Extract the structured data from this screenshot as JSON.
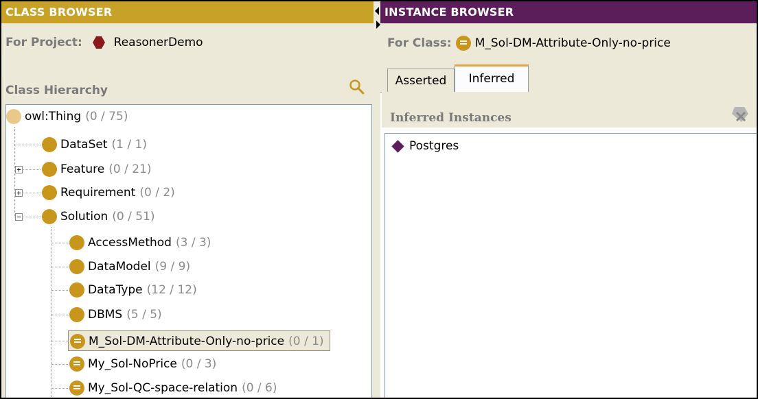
{
  "class_browser": {
    "header": "CLASS BROWSER",
    "project_label": "For Project:",
    "project_name": "ReasonerDemo",
    "hierarchy_title": "Class Hierarchy",
    "tree": [
      {
        "name": "owl:Thing",
        "count": "(0 / 75)"
      },
      {
        "name": "DataSet",
        "count": "(1 / 1)"
      },
      {
        "name": "Feature",
        "count": "(0 / 21)"
      },
      {
        "name": "Requirement",
        "count": "(0 / 2)"
      },
      {
        "name": "Solution",
        "count": "(0 / 51)"
      },
      {
        "name": "AccessMethod",
        "count": "(3 / 3)"
      },
      {
        "name": "DataModel",
        "count": "(9 / 9)"
      },
      {
        "name": "DataType",
        "count": "(12 / 12)"
      },
      {
        "name": "DBMS",
        "count": "(5 / 5)"
      },
      {
        "name": "M_Sol-DM-Attribute-Only-no-price",
        "count": "(0 / 1)"
      },
      {
        "name": "My_Sol-NoPrice",
        "count": "(0 / 3)"
      },
      {
        "name": "My_Sol-QC-space-relation",
        "count": "(0 / 6)"
      }
    ]
  },
  "instance_browser": {
    "header": "INSTANCE BROWSER",
    "class_label": "For Class:",
    "class_name": "M_Sol-DM-Attribute-Only-no-price",
    "tabs": [
      "Asserted",
      "Inferred"
    ],
    "active_tab": "Inferred",
    "inferred_title": "Inferred Instances",
    "instances": [
      "Postgres"
    ]
  },
  "colors": {
    "class_header": "#c8a227",
    "instance_header": "#5c1e5a",
    "class_icon": "#c9961c",
    "project_icon": "#8b1a1a",
    "instance_icon": "#5c1e5a"
  }
}
